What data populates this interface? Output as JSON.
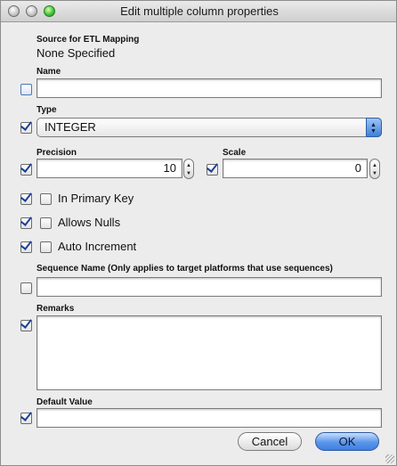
{
  "window": {
    "title": "Edit multiple column properties"
  },
  "source": {
    "label": "Source for ETL Mapping",
    "value": "None Specified"
  },
  "name": {
    "label": "Name",
    "value": ""
  },
  "type": {
    "label": "Type",
    "selected": "INTEGER"
  },
  "precision": {
    "label": "Precision",
    "value": "10"
  },
  "scale": {
    "label": "Scale",
    "value": "0"
  },
  "flags": {
    "primary_key": "In Primary Key",
    "allows_nulls": "Allows Nulls",
    "auto_increment": "Auto Increment"
  },
  "sequence": {
    "label": "Sequence Name (Only applies to target platforms that use sequences)",
    "value": ""
  },
  "remarks": {
    "label": "Remarks",
    "value": ""
  },
  "default_value": {
    "label": "Default Value",
    "value": ""
  },
  "buttons": {
    "cancel": "Cancel",
    "ok": "OK"
  }
}
